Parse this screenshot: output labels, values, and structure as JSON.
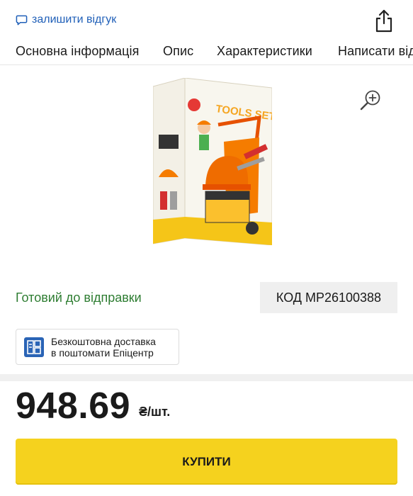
{
  "header": {
    "review_label": "залишити відгук",
    "review_icon": "chat-bubble-icon",
    "share_icon": "share-icon"
  },
  "tabs": [
    {
      "label": "Основна інформація"
    },
    {
      "label": "Опис"
    },
    {
      "label": "Характеристики"
    },
    {
      "label": "Написати відгук"
    }
  ],
  "gallery": {
    "zoom_icon": "zoom-in-icon",
    "box_brand": "TOOLS SET"
  },
  "status_text": "Готовий до відправки",
  "code_text": "КОД MP26100388",
  "delivery": {
    "icon": "parcel-locker-icon",
    "line1": "Безкоштовна доставка",
    "line2": "в поштомати Епіцентр"
  },
  "price": {
    "value": "948.69",
    "unit": "₴/шт."
  },
  "buy_label": "КУПИТИ",
  "colors": {
    "accent_blue": "#1f5fb8",
    "status_green": "#2e7d32",
    "buy_yellow": "#f5d21e"
  }
}
